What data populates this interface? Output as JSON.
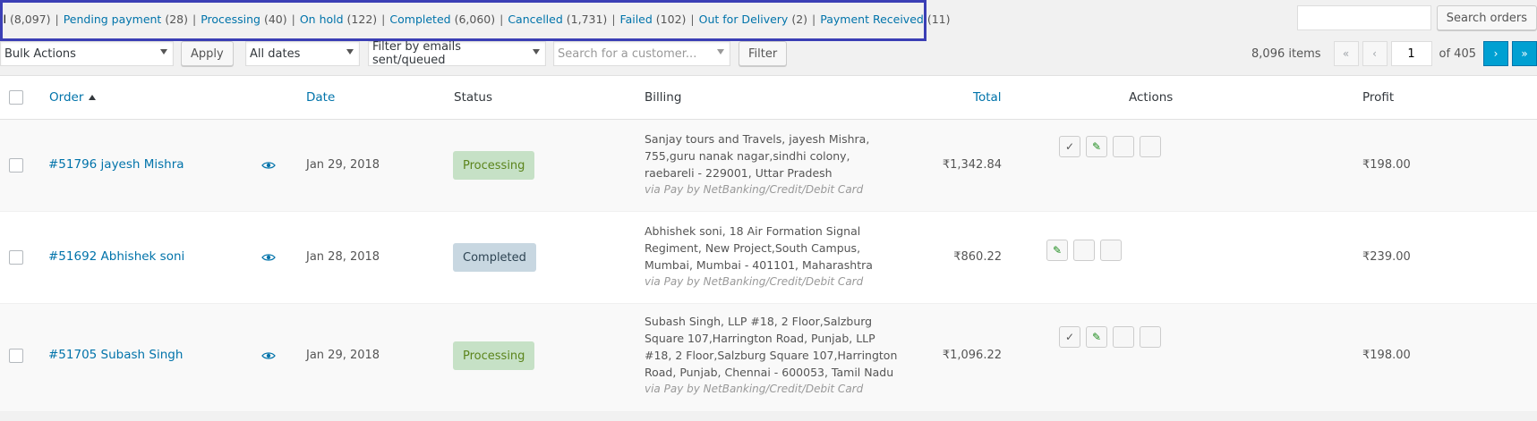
{
  "status_filters": [
    {
      "label": "ll",
      "count": "(8,097)",
      "current": true
    },
    {
      "label": "Pending payment",
      "count": "(28)"
    },
    {
      "label": "Processing",
      "count": "(40)"
    },
    {
      "label": "On hold",
      "count": "(122)"
    },
    {
      "label": "Completed",
      "count": "(6,060)"
    },
    {
      "label": "Cancelled",
      "count": "(1,731)"
    },
    {
      "label": "Failed",
      "count": "(102)"
    },
    {
      "label": "Out for Delivery",
      "count": "(2)"
    },
    {
      "label": "Payment Received",
      "count": "(11)"
    }
  ],
  "search": {
    "value": "",
    "button_label": "Search orders"
  },
  "tablenav": {
    "bulk_actions": "Bulk Actions",
    "apply_label": "Apply",
    "dates": "All dates",
    "email_filter": "Filter by emails sent/queued",
    "customer_placeholder": "Search for a customer...",
    "filter_label": "Filter"
  },
  "pagination": {
    "items": "8,096 items",
    "first": "«",
    "prev": "‹",
    "current_page": "1",
    "of": "of 405",
    "next": "›",
    "last": "»"
  },
  "columns": {
    "order": "Order",
    "date": "Date",
    "status": "Status",
    "billing": "Billing",
    "total": "Total",
    "actions": "Actions",
    "profit": "Profit"
  },
  "orders": [
    {
      "order": "#51796 jayesh Mishra",
      "date": "Jan 29, 2018",
      "status": "Processing",
      "billing": [
        "Sanjay tours and Travels, jayesh Mishra,",
        "755,guru nanak nagar,sindhi colony,",
        "raebareli - 229001, Uttar Pradesh"
      ],
      "via": "via Pay by NetBanking/Credit/Debit Card",
      "total": "₹1,342.84",
      "profit": "₹198.00"
    },
    {
      "order": "#51692 Abhishek soni",
      "date": "Jan 28, 2018",
      "status": "Completed",
      "billing": [
        "Abhishek soni, 18 Air Formation Signal",
        "Regiment, New Project,South Campus,",
        "Mumbai, Mumbai - 401101, Maharashtra"
      ],
      "via": "via Pay by NetBanking/Credit/Debit Card",
      "total": "₹860.22",
      "profit": "₹239.00"
    },
    {
      "order": "#51705 Subash Singh",
      "date": "Jan 29, 2018",
      "status": "Processing",
      "billing": [
        "Subash Singh, LLP #18, 2 Floor,Salzburg",
        "Square 107,Harrington Road, Punjab, LLP",
        "#18, 2 Floor,Salzburg Square 107,Harrington",
        "Road, Punjab, Chennai - 600053, Tamil Nadu"
      ],
      "via": "via Pay by NetBanking/Credit/Debit Card",
      "total": "₹1,096.22",
      "profit": "₹198.00"
    }
  ],
  "colors": {
    "accent": "#0073aa",
    "highlight_border": "#3b3fb5",
    "processing_bg": "#c6e1c6",
    "completed_bg": "#c8d7e1"
  },
  "icons": {
    "complete": "check-icon",
    "edit": "edit-icon",
    "view_order": "eye-icon"
  }
}
